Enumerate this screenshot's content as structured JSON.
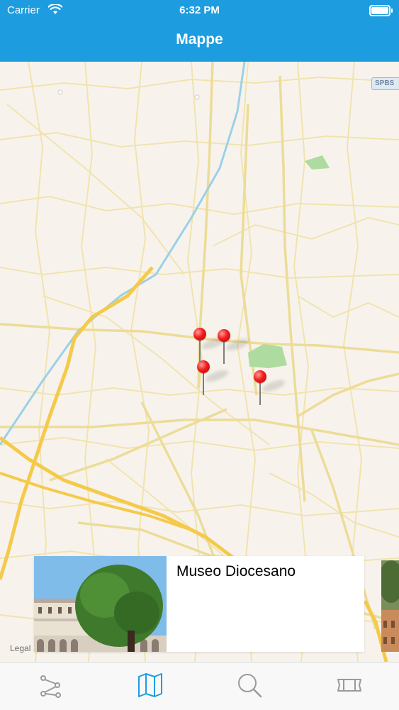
{
  "status_bar": {
    "carrier": "Carrier",
    "time": "6:32 PM",
    "wifi_icon": "wifi-icon",
    "battery_icon": "battery-icon"
  },
  "nav": {
    "title": "Mappe"
  },
  "map": {
    "road_badge": "SPBS",
    "legal_label": "Legal",
    "pins": [
      {
        "name": "map-pin-1",
        "icon": "map-pin-icon"
      },
      {
        "name": "map-pin-2",
        "icon": "map-pin-icon"
      },
      {
        "name": "map-pin-3",
        "icon": "map-pin-icon"
      },
      {
        "name": "map-pin-4",
        "icon": "map-pin-icon"
      }
    ]
  },
  "cards": [
    {
      "title": "Museo Diocesano",
      "image": "museum-cloister-photo"
    },
    {
      "title": "",
      "image": "next-place-photo"
    }
  ],
  "tab_bar": {
    "items": [
      {
        "icon": "route-icon",
        "label": "",
        "selected": false
      },
      {
        "icon": "map-icon",
        "label": "",
        "selected": true
      },
      {
        "icon": "search-icon",
        "label": "",
        "selected": false
      },
      {
        "icon": "ticket-icon",
        "label": "",
        "selected": false
      }
    ]
  },
  "colors": {
    "bar_blue": "#1d9ddf",
    "map_bg": "#f7f3ec",
    "road_yellow": "#f6e08b",
    "highway": "#f5c94a",
    "river": "#9cd0e8",
    "park_green": "#aedba0",
    "tab_inactive": "#9a9a9a",
    "tab_active": "#1d9ddf"
  }
}
